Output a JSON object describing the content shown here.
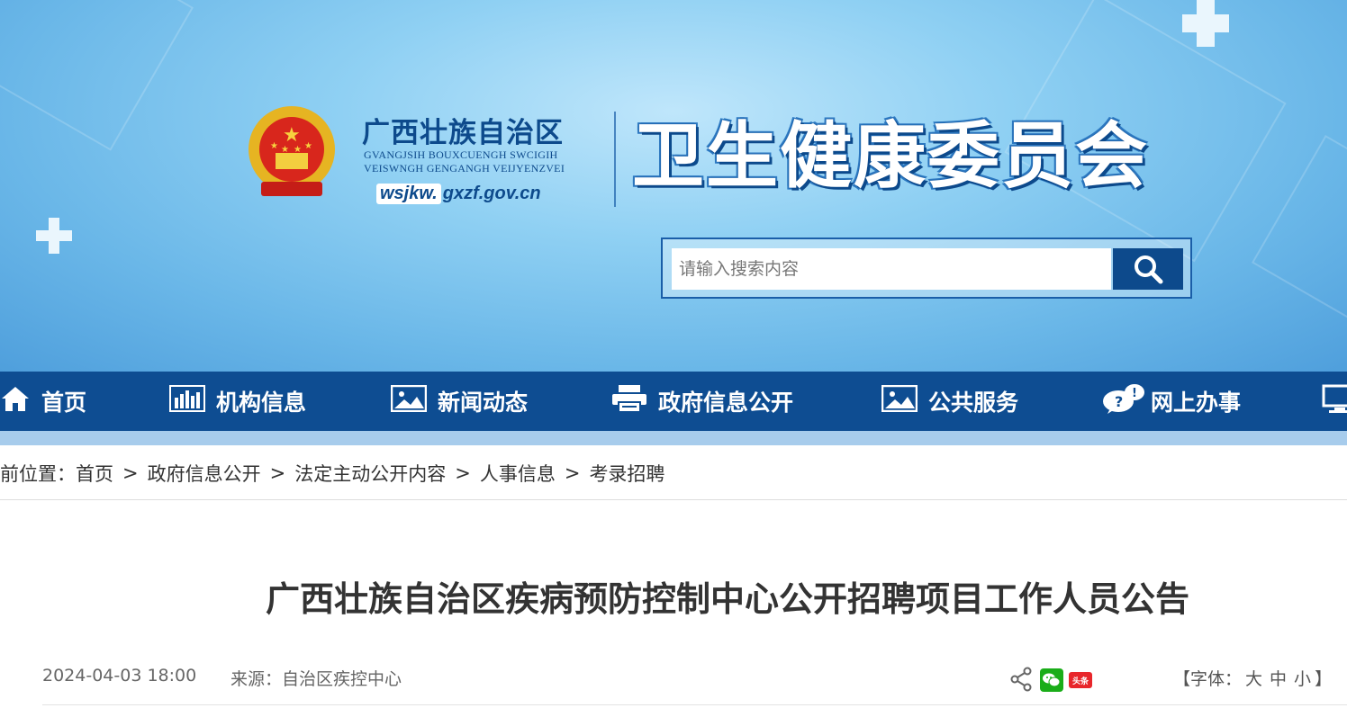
{
  "header": {
    "region_cn": "广西壮族自治区",
    "region_zh_line1": "GVANGJSIH BOUXCUENGH SWCIGIH",
    "region_zh_line2": "VEISWNGH GENGANGH VEIJYENZVEI",
    "domain_prefix": "wsjkw.",
    "domain_suffix": "gxzf.gov.cn",
    "site_name": "卫生健康委员会",
    "emblem_icon": "national-emblem-icon"
  },
  "search": {
    "placeholder": "请输入搜索内容",
    "button_icon": "search-icon"
  },
  "nav": {
    "items": [
      {
        "label": "首页",
        "icon": "home-icon"
      },
      {
        "label": "机构信息",
        "icon": "bar-chart-icon"
      },
      {
        "label": "新闻动态",
        "icon": "image-icon"
      },
      {
        "label": "政府信息公开",
        "icon": "printer-icon"
      },
      {
        "label": "公共服务",
        "icon": "image-icon"
      },
      {
        "label": "网上办事",
        "icon": "chat-bubbles-icon"
      }
    ]
  },
  "breadcrumb": {
    "prefix": "前位置：",
    "items": [
      "首页",
      "政府信息公开",
      "法定主动公开内容",
      "人事信息",
      "考录招聘"
    ],
    "separator": ">"
  },
  "article": {
    "title": "广西壮族自治区疾病预防控制中心公开招聘项目工作人员公告",
    "date": "2024-04-03 18:00",
    "source": "来源：自治区疾控中心"
  },
  "share": {
    "share_icon": "share-icon",
    "wechat_icon": "wechat-icon",
    "toutiao_icon": "toutiao-icon",
    "toutiao_text": "头条"
  },
  "font_size": {
    "open": "【字体：",
    "large": "大",
    "medium": "中",
    "small": "小",
    "close": "】"
  },
  "colors": {
    "nav_bg": "#0e4d92",
    "brand_blue": "#0d4a8c",
    "emblem_red": "#d8261c",
    "emblem_gold": "#e6b422"
  }
}
